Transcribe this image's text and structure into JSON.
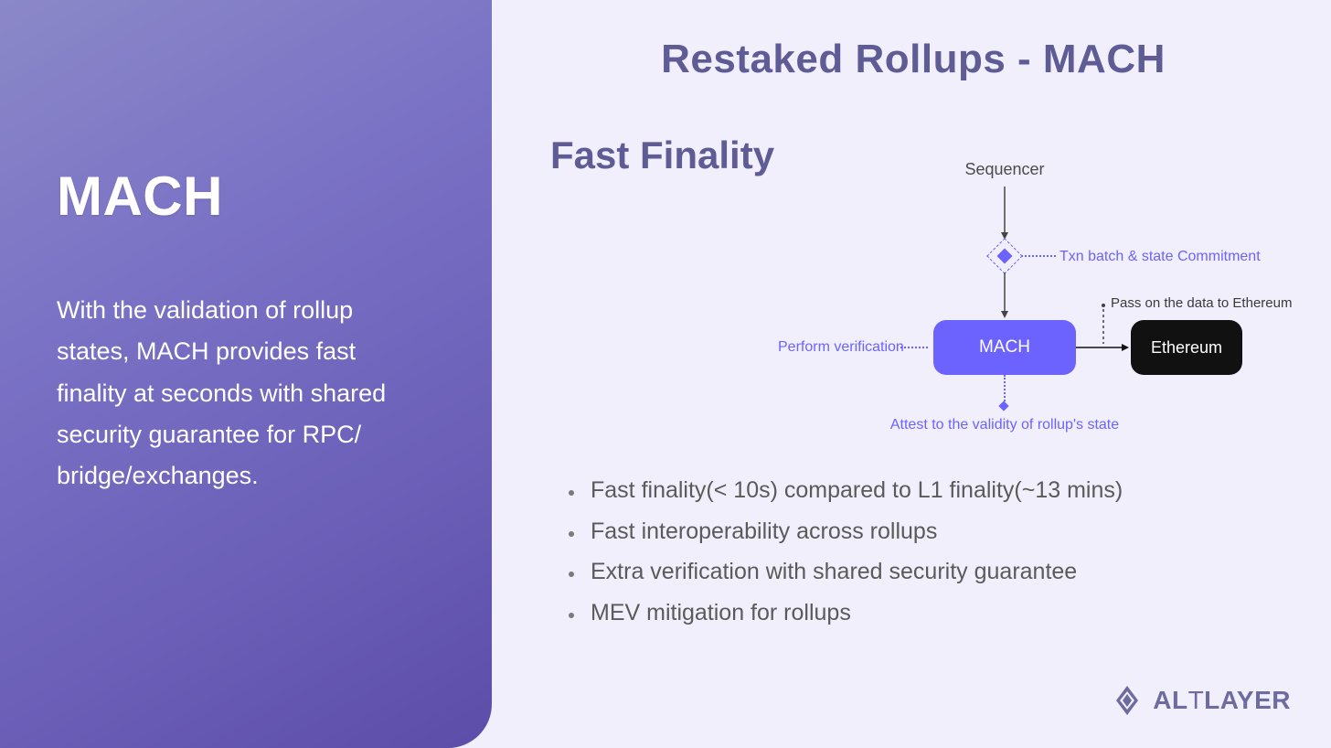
{
  "left": {
    "title": "MACH",
    "description": "With the validation of rollup states, MACH provides fast finality at seconds with shared security guarantee for RPC/ bridge/exchanges."
  },
  "right": {
    "main_title": "Restaked Rollups - MACH",
    "subtitle": "Fast Finality",
    "diagram": {
      "sequencer": "Sequencer",
      "txn_label": "Txn batch & state Commitment",
      "mach": "MACH",
      "ethereum": "Ethereum",
      "perform": "Perform verification",
      "pass": "Pass on the data to Ethereum",
      "attest": "Attest to the validity of rollup's state"
    },
    "bullets": [
      "Fast finality(< 10s) compared to L1 finality(~13 mins)",
      "Fast interoperability across rollups",
      "Extra verification with shared security guarantee",
      "MEV mitigation for rollups"
    ]
  },
  "brand": {
    "name_a": "AL",
    "name_b": "T",
    "name_c": "LAYER"
  }
}
